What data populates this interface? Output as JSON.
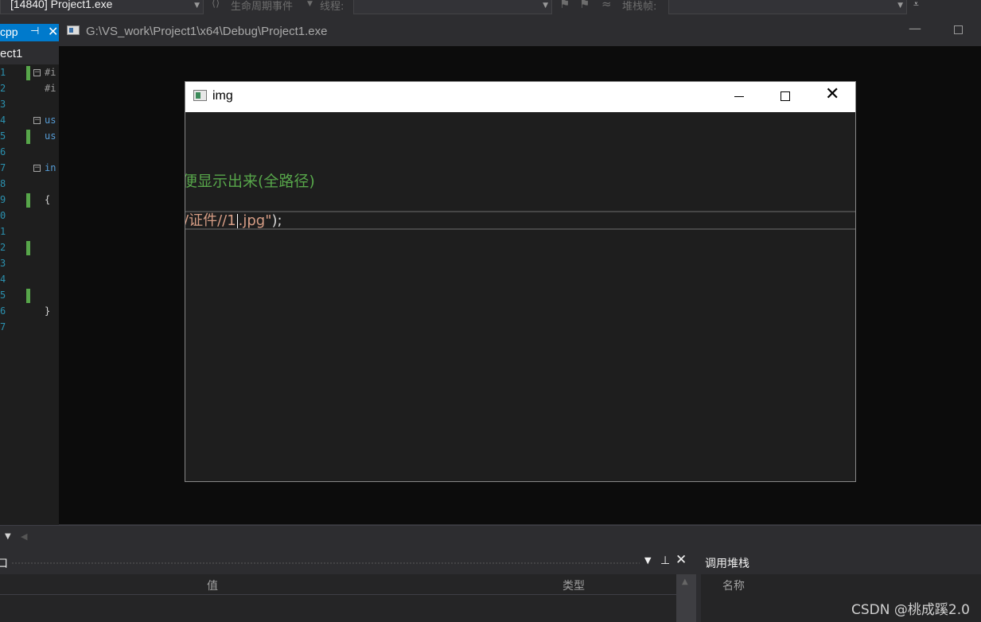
{
  "toolbar": {
    "process": "[14840] Project1.exe",
    "lifecycle_label": "生命周期事件",
    "thread_label": "线程:",
    "stack_frame_label": "堆栈帧:"
  },
  "editor": {
    "tab_label": "cpp",
    "project_label": "ect1",
    "line_numbers": [
      "1",
      "2",
      "3",
      "4",
      "5",
      "6",
      "7",
      "8",
      "9",
      "0",
      "1",
      "2",
      "3",
      "4",
      "5",
      "6",
      "7"
    ],
    "code_lines": {
      "l1": "#i",
      "l2": "#i",
      "l4": "us",
      "l5": "us",
      "l7": "in",
      "l9": "{",
      "l16": "}"
    }
  },
  "console": {
    "title": "G:\\VS_work\\Project1\\x64\\Debug\\Project1.exe"
  },
  "img_window": {
    "title": "img",
    "comment_text": "便显示出来(全路径)",
    "string_before_cursor": "/证件//1",
    "string_after_cursor": ".jpg\"",
    "string_tail": ");"
  },
  "watch_panel": {
    "title": "口",
    "col_value": "值",
    "col_type": "类型"
  },
  "callstack_panel": {
    "title": "调用堆栈",
    "col_name": "名称"
  },
  "watermark": "CSDN @桃成蹊2.0",
  "colors": {
    "accent": "#007acc",
    "comment": "#57a64a",
    "string": "#d69d85",
    "line_number": "#2b91af"
  }
}
